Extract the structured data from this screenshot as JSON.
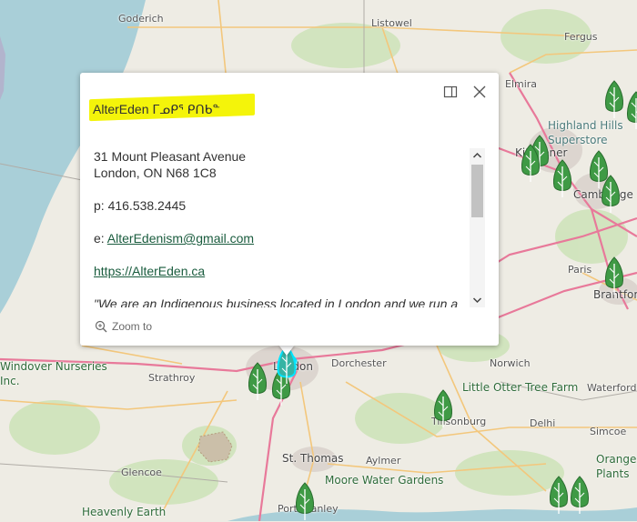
{
  "map": {
    "colors": {
      "land": "#eeece4",
      "water": "#a9cfd8",
      "road_major": "#e8799a",
      "road_minor": "#f3c77c",
      "forest": "#cde3b8",
      "town": "#dcd5cf"
    },
    "places": [
      {
        "id": "goderich",
        "label": "Goderich",
        "style": "normal"
      },
      {
        "id": "listowel",
        "label": "Listowel",
        "style": "normal"
      },
      {
        "id": "fergus",
        "label": "Fergus",
        "style": "normal"
      },
      {
        "id": "elmira",
        "label": "Elmira",
        "style": "normal"
      },
      {
        "id": "highland",
        "label": "Highland Hills",
        "style": "teal"
      },
      {
        "id": "superstore",
        "label": "Superstore",
        "style": "teal"
      },
      {
        "id": "kitchener",
        "label": "Kitchener",
        "style": "big"
      },
      {
        "id": "cambridge",
        "label": "Cambridge",
        "style": "big"
      },
      {
        "id": "paris",
        "label": "Paris",
        "style": "normal"
      },
      {
        "id": "brantford",
        "label": "Brantford",
        "style": "big"
      },
      {
        "id": "london",
        "label": "London",
        "style": "big"
      },
      {
        "id": "dorchester",
        "label": "Dorchester",
        "style": "normal"
      },
      {
        "id": "norwich",
        "label": "Norwich",
        "style": "normal"
      },
      {
        "id": "windover",
        "label": "Windover Nurseries",
        "style": "green"
      },
      {
        "id": "inc",
        "label": "Inc.",
        "style": "green"
      },
      {
        "id": "strathroy",
        "label": "Strathroy",
        "style": "normal"
      },
      {
        "id": "littleotter",
        "label": "Little Otter Tree Farm",
        "style": "green"
      },
      {
        "id": "waterford",
        "label": "Waterford",
        "style": "normal"
      },
      {
        "id": "tillsonburg",
        "label": "Tillsonburg",
        "style": "normal"
      },
      {
        "id": "delhi",
        "label": "Delhi",
        "style": "normal"
      },
      {
        "id": "simcoe",
        "label": "Simcoe",
        "style": "normal"
      },
      {
        "id": "glencoe",
        "label": "Glencoe",
        "style": "normal"
      },
      {
        "id": "stthomas",
        "label": "St. Thomas",
        "style": "big"
      },
      {
        "id": "aylmer",
        "label": "Aylmer",
        "style": "normal"
      },
      {
        "id": "moore",
        "label": "Moore Water Gardens",
        "style": "green"
      },
      {
        "id": "orange",
        "label": "Orange",
        "style": "green"
      },
      {
        "id": "plants",
        "label": "Plants",
        "style": "green"
      },
      {
        "id": "heavenly",
        "label": "Heavenly Earth",
        "style": "green"
      },
      {
        "id": "portstanley",
        "label": "Port Stanley",
        "style": "normal"
      }
    ]
  },
  "popup": {
    "title": "AlterEden ᒥᓄᑭᕐ ᑭᑎᑲᓐ",
    "address_line1": "31 Mount Pleasant Avenue",
    "address_line2": "London, ON N68 1C8",
    "phone": "p: 416.538.2445",
    "email_prefix": "e: ",
    "email": "AlterEdenism@gmail.com",
    "website": "https://AlterEden.ca",
    "description": "\"We are an Indigenous business located in London and we run a",
    "zoom_label": "Zoom to"
  }
}
